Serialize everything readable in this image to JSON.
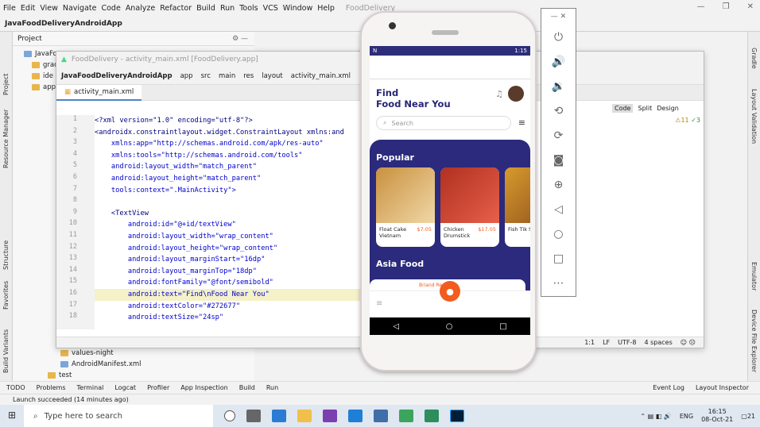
{
  "menu": {
    "items": [
      "File",
      "Edit",
      "View",
      "Navigate",
      "Code",
      "Analyze",
      "Refactor",
      "Build",
      "Run",
      "Tools",
      "VCS",
      "Window",
      "Help"
    ],
    "title": "FoodDelivery"
  },
  "breadcrumb": {
    "root": "JavaFoodDeliveryAndroidApp"
  },
  "left_strip": {
    "project": "Project",
    "resource_manager": "Resource Manager",
    "structure": "Structure",
    "favorites": "Favorites",
    "build_variants": "Build Variants"
  },
  "right_strip": {
    "gradle": "Gradle",
    "layout_validation": "Layout Validation",
    "emulator": "Emulator",
    "device_file_explorer": "Device File Explorer"
  },
  "project_pane": {
    "header": "Project",
    "tree": [
      "JavaFo",
      "grad",
      "ide",
      "app"
    ],
    "bottom": [
      "values-night",
      "AndroidManifest.xml",
      "test"
    ]
  },
  "editor": {
    "window_title": "FoodDelivery - activity_main.xml [FoodDelivery.app]",
    "crumbs": [
      "JavaFoodDeliveryAndroidApp",
      "app",
      "src",
      "main",
      "res",
      "layout",
      "activity_main.xml"
    ],
    "tab": "activity_main.xml",
    "view_modes": {
      "code": "Code",
      "split": "Split",
      "design": "Design"
    },
    "warnings": "11",
    "checks": "3",
    "line_numbers": [
      "1",
      "2",
      "3",
      "4",
      "5",
      "6",
      "7",
      "8",
      "9",
      "10",
      "11",
      "12",
      "13",
      "14",
      "15",
      "16",
      "17",
      "18"
    ],
    "lines": {
      "l1": "<?xml version=\"1.0\" encoding=\"utf-8\"?>",
      "l2": "<androidx.constraintlayout.widget.ConstraintLayout xmlns:and",
      "l3": "    xmlns:app=\"http://schemas.android.com/apk/res-auto\"",
      "l4": "    xmlns:tools=\"http://schemas.android.com/tools\"",
      "l5": "    android:layout_width=\"match_parent\"",
      "l6": "    android:layout_height=\"match_parent\"",
      "l7": "    tools:context=\".MainActivity\">",
      "l8": "",
      "l9": "    <TextView",
      "l10": "        android:id=\"@+id/textView\"",
      "l11": "        android:layout_width=\"wrap_content\"",
      "l12": "        android:layout_height=\"wrap_content\"",
      "l13": "        android:layout_marginStart=\"16dp\"",
      "l14": "        android:layout_marginTop=\"18dp\"",
      "l15": "        android:fontFamily=\"@font/semibold\"",
      "l16": "        android:text=\"Find\\nFood Near You\"",
      "l17": "        android:textColor=\"#272677\"",
      "l18": "        android:textSize=\"24sp\""
    },
    "status": {
      "pos": "1:1",
      "lf": "LF",
      "enc": "UTF-8",
      "indent": "4 spaces"
    }
  },
  "phone": {
    "status_left": "N",
    "time": "1:15",
    "title": "Find\nFood Near You",
    "search_placeholder": "Search",
    "popular": "Popular",
    "cards": [
      {
        "name": "Float Cake Vietnam",
        "price": "$7.05"
      },
      {
        "name": "Chicken Drumstick",
        "price": "$17.05"
      },
      {
        "name": "Fish Tik Stick",
        "price": ""
      }
    ],
    "asia": "Asia Food",
    "asia_item": "Briand Re"
  },
  "bottom_tabs": [
    "TODO",
    "Problems",
    "Terminal",
    "Logcat",
    "Profiler",
    "App Inspection",
    "Build",
    "Run"
  ],
  "bottom_right": [
    "Event Log",
    "Layout Inspector"
  ],
  "status_msg": "Launch succeeded (14 minutes ago)",
  "taskbar": {
    "search": "Type here to search",
    "lang": "ENG",
    "time": "16:15",
    "date": "08-Oct-21",
    "notif": "21"
  }
}
